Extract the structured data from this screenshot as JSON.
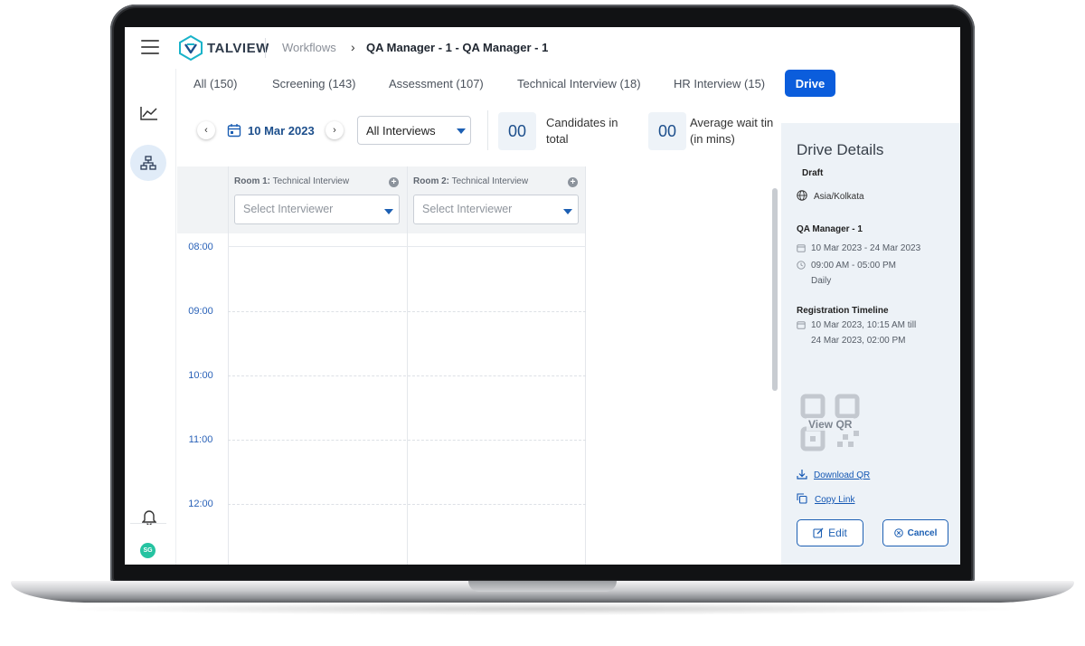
{
  "app": {
    "brand": "TALVIEW"
  },
  "breadcrumb": {
    "parent": "Workflows",
    "current": "QA Manager - 1 - QA Manager - 1"
  },
  "tabs": [
    {
      "label": "All (150)"
    },
    {
      "label": "Screening (143)"
    },
    {
      "label": "Assessment (107)"
    },
    {
      "label": "Technical Interview (18)"
    },
    {
      "label": "HR Interview (15)"
    },
    {
      "label": "Drive",
      "active": true
    }
  ],
  "toolbar": {
    "date": "10 Mar 2023",
    "filter_value": "All Interviews"
  },
  "stats": [
    {
      "value": "00",
      "label_line1": "Candidates in",
      "label_line2": "total"
    },
    {
      "value": "00",
      "label_line1": "Average wait tin",
      "label_line2": "(in mins)"
    }
  ],
  "schedule": {
    "rooms": [
      {
        "prefix": "Room 1:",
        "type": "Technical Interview",
        "placeholder": "Select Interviewer"
      },
      {
        "prefix": "Room 2:",
        "type": "Technical Interview",
        "placeholder": "Select Interviewer"
      }
    ],
    "times": [
      "08:00",
      "09:00",
      "10:00",
      "11:00",
      "12:00"
    ]
  },
  "sidebar": {
    "avatar_initials": "SG"
  },
  "drive_details": {
    "title": "Drive Details",
    "status": "Draft",
    "timezone": "Asia/Kolkata",
    "name": "QA Manager - 1",
    "date_range": "10 Mar 2023 - 24 Mar 2023",
    "time_range": "09:00 AM - 05:00 PM",
    "frequency": "Daily",
    "registration_heading": "Registration Timeline",
    "registration_line1": "10 Mar 2023, 10:15 AM till",
    "registration_line2": "24 Mar 2023, 02:00 PM",
    "view_qr": "View QR",
    "download_qr": "Download QR",
    "copy_link": "Copy Link",
    "edit_label": "Edit",
    "cancel_label": "Cancel"
  },
  "colors": {
    "accent": "#0b5ddc",
    "link": "#1457b3",
    "panel_bg": "#edf2f7"
  }
}
